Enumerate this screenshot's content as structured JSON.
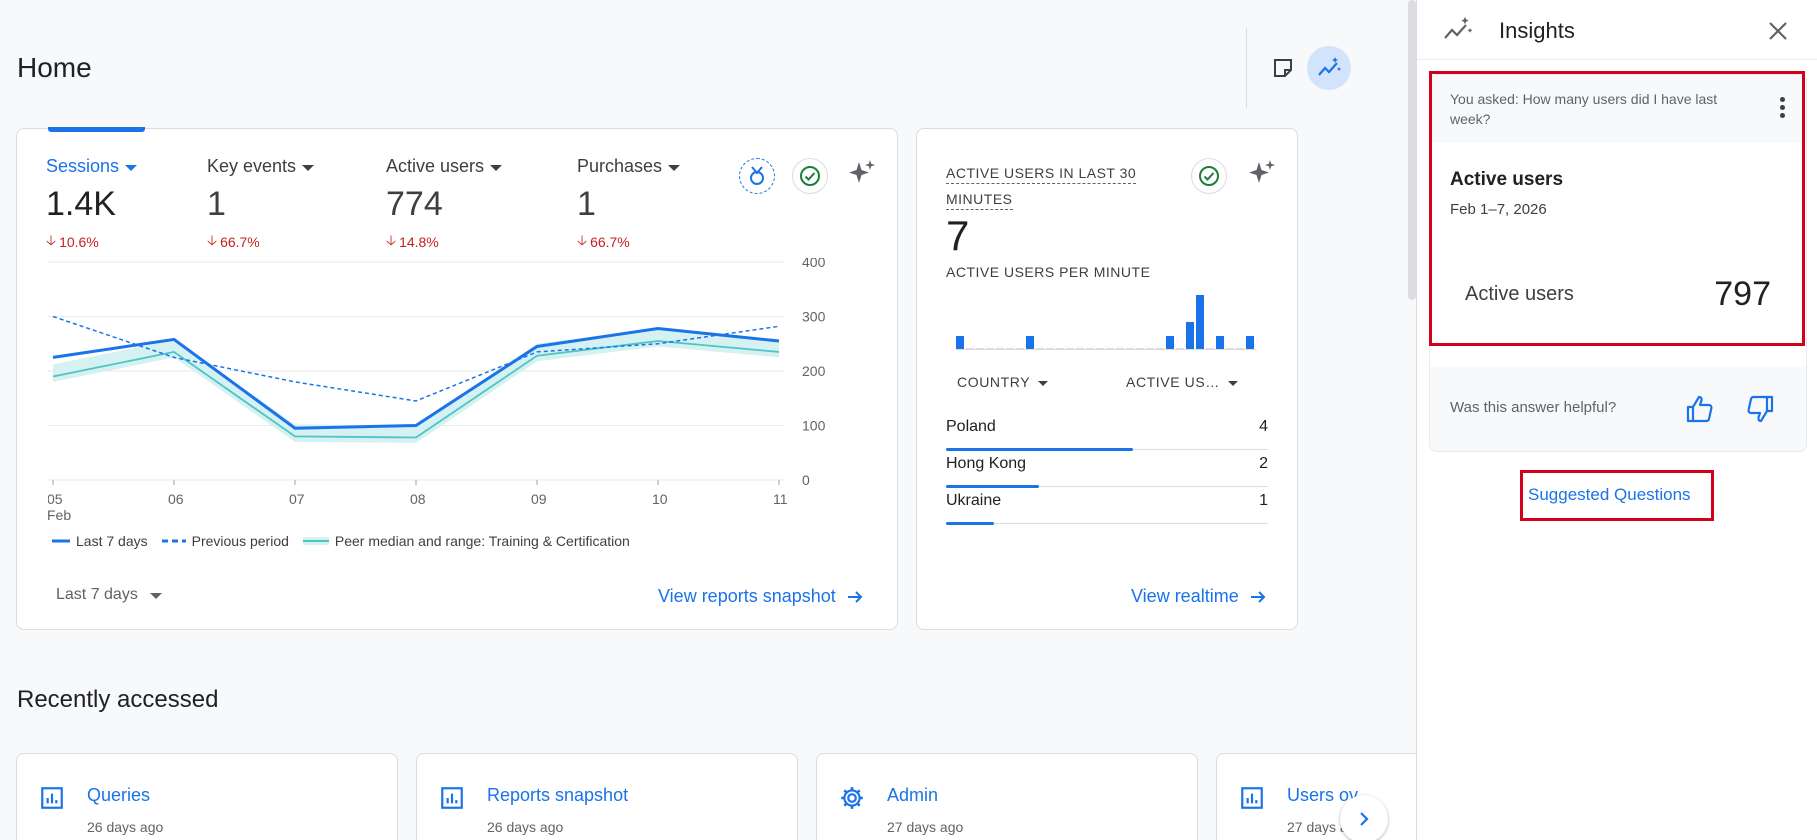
{
  "header": {
    "title": "Home"
  },
  "overview": {
    "metrics": [
      {
        "label": "Sessions",
        "value": "1.4K",
        "change": "10.6%",
        "active": true
      },
      {
        "label": "Key events",
        "value": "1",
        "change": "66.7%",
        "active": false
      },
      {
        "label": "Active users",
        "value": "774",
        "change": "14.8%",
        "active": false
      },
      {
        "label": "Purchases",
        "value": "1",
        "change": "66.7%",
        "active": false
      }
    ],
    "date_range": "Last 7 days",
    "view_link": "View reports snapshot",
    "legend": {
      "current": "Last 7 days",
      "previous": "Previous period",
      "peer": "Peer median and range: Training & Certification"
    },
    "colors": {
      "current": "#1a73e8",
      "previous": "#1a73e8",
      "peer": "#4ec4c4",
      "peer_band": "#d6f1f1"
    }
  },
  "chart_data": {
    "type": "line",
    "x": [
      "05",
      "06",
      "07",
      "08",
      "09",
      "10",
      "11"
    ],
    "x_sublabel": "Feb",
    "y_ticks": [
      "400",
      "300",
      "200",
      "100",
      "0"
    ],
    "ylim": [
      0,
      400
    ],
    "series": [
      {
        "name": "Last 7 days",
        "values": [
          225,
          258,
          95,
          100,
          245,
          278,
          255
        ]
      },
      {
        "name": "Previous period",
        "values": [
          300,
          225,
          180,
          145,
          235,
          250,
          282
        ]
      },
      {
        "name": "Peer median and range: Training & Certification",
        "values": [
          190,
          235,
          80,
          78,
          228,
          255,
          235
        ]
      }
    ]
  },
  "realtime": {
    "heading_line1": "ACTIVE USERS IN LAST 30",
    "heading_line2": "MINUTES",
    "count": "7",
    "per_minute": "ACTIVE USERS PER MINUTE",
    "bars": [
      1,
      0,
      0,
      0,
      0,
      0,
      0,
      1,
      0,
      0,
      0,
      0,
      0,
      0,
      0,
      0,
      0,
      0,
      0,
      0,
      0,
      1,
      0,
      2,
      4,
      0,
      1,
      0,
      0,
      1
    ],
    "col_country": "COUNTRY",
    "col_users": "ACTIVE US…",
    "rows": [
      {
        "country": "Poland",
        "users": "4",
        "share": 0.58
      },
      {
        "country": "Hong Kong",
        "users": "2",
        "share": 0.29
      },
      {
        "country": "Ukraine",
        "users": "1",
        "share": 0.15
      }
    ],
    "view_link": "View realtime"
  },
  "recent": {
    "title": "Recently accessed",
    "items": [
      {
        "title": "Queries",
        "sub": "26 days ago",
        "icon": "chart-icon"
      },
      {
        "title": "Reports snapshot",
        "sub": "26 days ago",
        "icon": "chart-icon"
      },
      {
        "title": "Admin",
        "sub": "27 days ago",
        "icon": "gear-icon"
      },
      {
        "title": "Users ov",
        "sub": "27 days a",
        "icon": "chart-icon"
      }
    ]
  },
  "insights": {
    "title": "Insights",
    "asked": "You asked: How many users did I have last week?",
    "answer_title": "Active users",
    "answer_date": "Feb 1–7, 2026",
    "metric_label": "Active users",
    "metric_value": "797",
    "helpful": "Was this answer helpful?",
    "suggested": "Suggested Questions"
  }
}
